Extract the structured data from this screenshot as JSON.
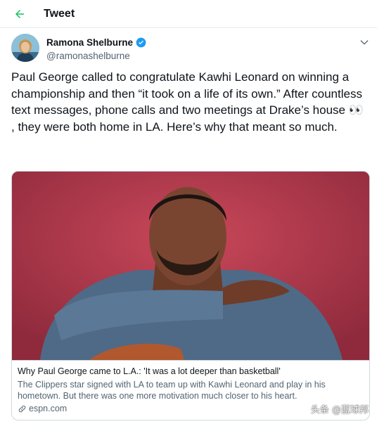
{
  "header": {
    "title": "Tweet",
    "back_icon": "arrow-left-icon"
  },
  "author": {
    "name": "Ramona Shelburne",
    "handle": "@ramonashelburne",
    "verified_icon": "verified-badge-icon",
    "menu_icon": "chevron-down-icon"
  },
  "tweet": {
    "text": "Paul George called to congratulate Kawhi Leonard on winning a championship and then “it took on a life of its own.” After countless text messages, phone calls and two meetings at Drake’s house 👀 , they were both home in LA. Here’s why that meant so much."
  },
  "card": {
    "title": "Why Paul George came to L.A.: 'It was a lot deeper than basketball'",
    "description": "The Clippers star signed with LA to team up with Kawhi Leonard and play in his hometown. But there was one more motivation much closer to his heart.",
    "domain": "espn.com",
    "link_icon": "link-icon"
  },
  "watermark": "头条 @蓝球邦",
  "colors": {
    "accent": "#1d9bf0",
    "back_arrow": "#17bf63",
    "card_background": "#b63a4b"
  }
}
